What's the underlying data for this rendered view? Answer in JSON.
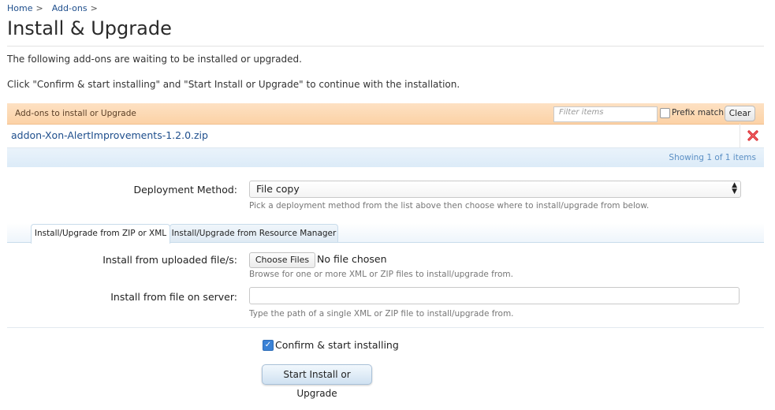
{
  "breadcrumb": [
    {
      "label": "Home",
      "sep": ">"
    },
    {
      "label": "Add-ons",
      "sep": ">"
    }
  ],
  "page": {
    "title": "Install & Upgrade",
    "intro": "The following add-ons are waiting to be installed or upgraded.",
    "instruction": "Click \"Confirm & start installing\" and \"Start Install or Upgrade\" to continue with the installation."
  },
  "addon_list": {
    "header_label": "Add-ons to install or Upgrade",
    "filter_placeholder": "Filter items",
    "prefix_match_label": "Prefix match",
    "prefix_match_checked": false,
    "clear_label": "Clear",
    "items": [
      {
        "name": "addon-Xon-AlertImprovements-1.2.0.zip",
        "delete_icon": "red-x-icon"
      }
    ],
    "footer": "Showing 1 of 1 items"
  },
  "form": {
    "deployment_label": "Deployment Method:",
    "deployment_value": "File copy",
    "deployment_hint": "Pick a deployment method from the list above then choose where to install/upgrade from below.",
    "tabs": [
      {
        "label": "Install/Upgrade from ZIP or XML",
        "active": true
      },
      {
        "label": "Install/Upgrade from Resource Manager",
        "active": false
      }
    ],
    "upload_label": "Install from uploaded file/s:",
    "choose_files_label": "Choose Files",
    "no_file_text": "No file chosen",
    "upload_hint": "Browse for one or more XML or ZIP files to install/upgrade from.",
    "server_label": "Install from file on server:",
    "server_value": "",
    "server_hint": "Type the path of a single XML or ZIP file to install/upgrade from.",
    "confirm_label": "Confirm & start installing",
    "confirm_checked": true,
    "submit_label": "Start Install or Upgrade"
  },
  "colors": {
    "link": "#1e4e8c",
    "header_bg": "#fcd2a6",
    "footer_bg": "#dcebf8",
    "delete": "#d9262b",
    "checkbox": "#3b82d6"
  }
}
